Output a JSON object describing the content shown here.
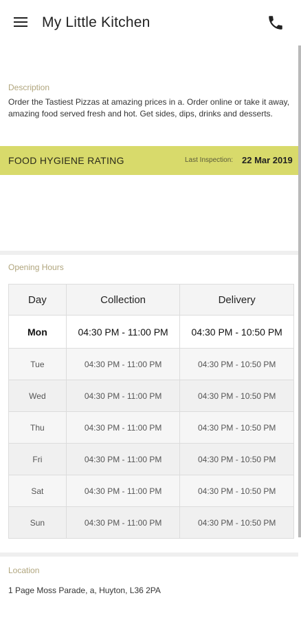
{
  "app_bar": {
    "title": "My Little Kitchen",
    "menu_icon": "hamburger-menu-icon",
    "call_icon": "phone-icon"
  },
  "description": {
    "label": "Description",
    "text": "Order the Tastiest Pizzas at amazing prices in a. Order online or take it away, amazing food served fresh and hot. Get sides, dips, drinks and desserts."
  },
  "hygiene": {
    "title": "FOOD HYGIENE RATING",
    "inspection_label": "Last Inspection:",
    "inspection_date": "22 Mar 2019",
    "band_color": "#d8da6b"
  },
  "opening_hours": {
    "label": "Opening Hours",
    "headers": [
      "Day",
      "Collection",
      "Delivery"
    ],
    "rows": [
      {
        "day": "Mon",
        "collection": "04:30 PM - 11:00 PM",
        "delivery": "04:30 PM - 10:50 PM",
        "today": true
      },
      {
        "day": "Tue",
        "collection": "04:30 PM - 11:00 PM",
        "delivery": "04:30 PM - 10:50 PM",
        "today": false
      },
      {
        "day": "Wed",
        "collection": "04:30 PM - 11:00 PM",
        "delivery": "04:30 PM - 10:50 PM",
        "today": false
      },
      {
        "day": "Thu",
        "collection": "04:30 PM - 11:00 PM",
        "delivery": "04:30 PM - 10:50 PM",
        "today": false
      },
      {
        "day": "Fri",
        "collection": "04:30 PM - 11:00 PM",
        "delivery": "04:30 PM - 10:50 PM",
        "today": false
      },
      {
        "day": "Sat",
        "collection": "04:30 PM - 11:00 PM",
        "delivery": "04:30 PM - 10:50 PM",
        "today": false
      },
      {
        "day": "Sun",
        "collection": "04:30 PM - 11:00 PM",
        "delivery": "04:30 PM - 10:50 PM",
        "today": false
      }
    ]
  },
  "location": {
    "label": "Location",
    "address": "1 Page Moss Parade, a, Huyton, L36 2PA"
  }
}
